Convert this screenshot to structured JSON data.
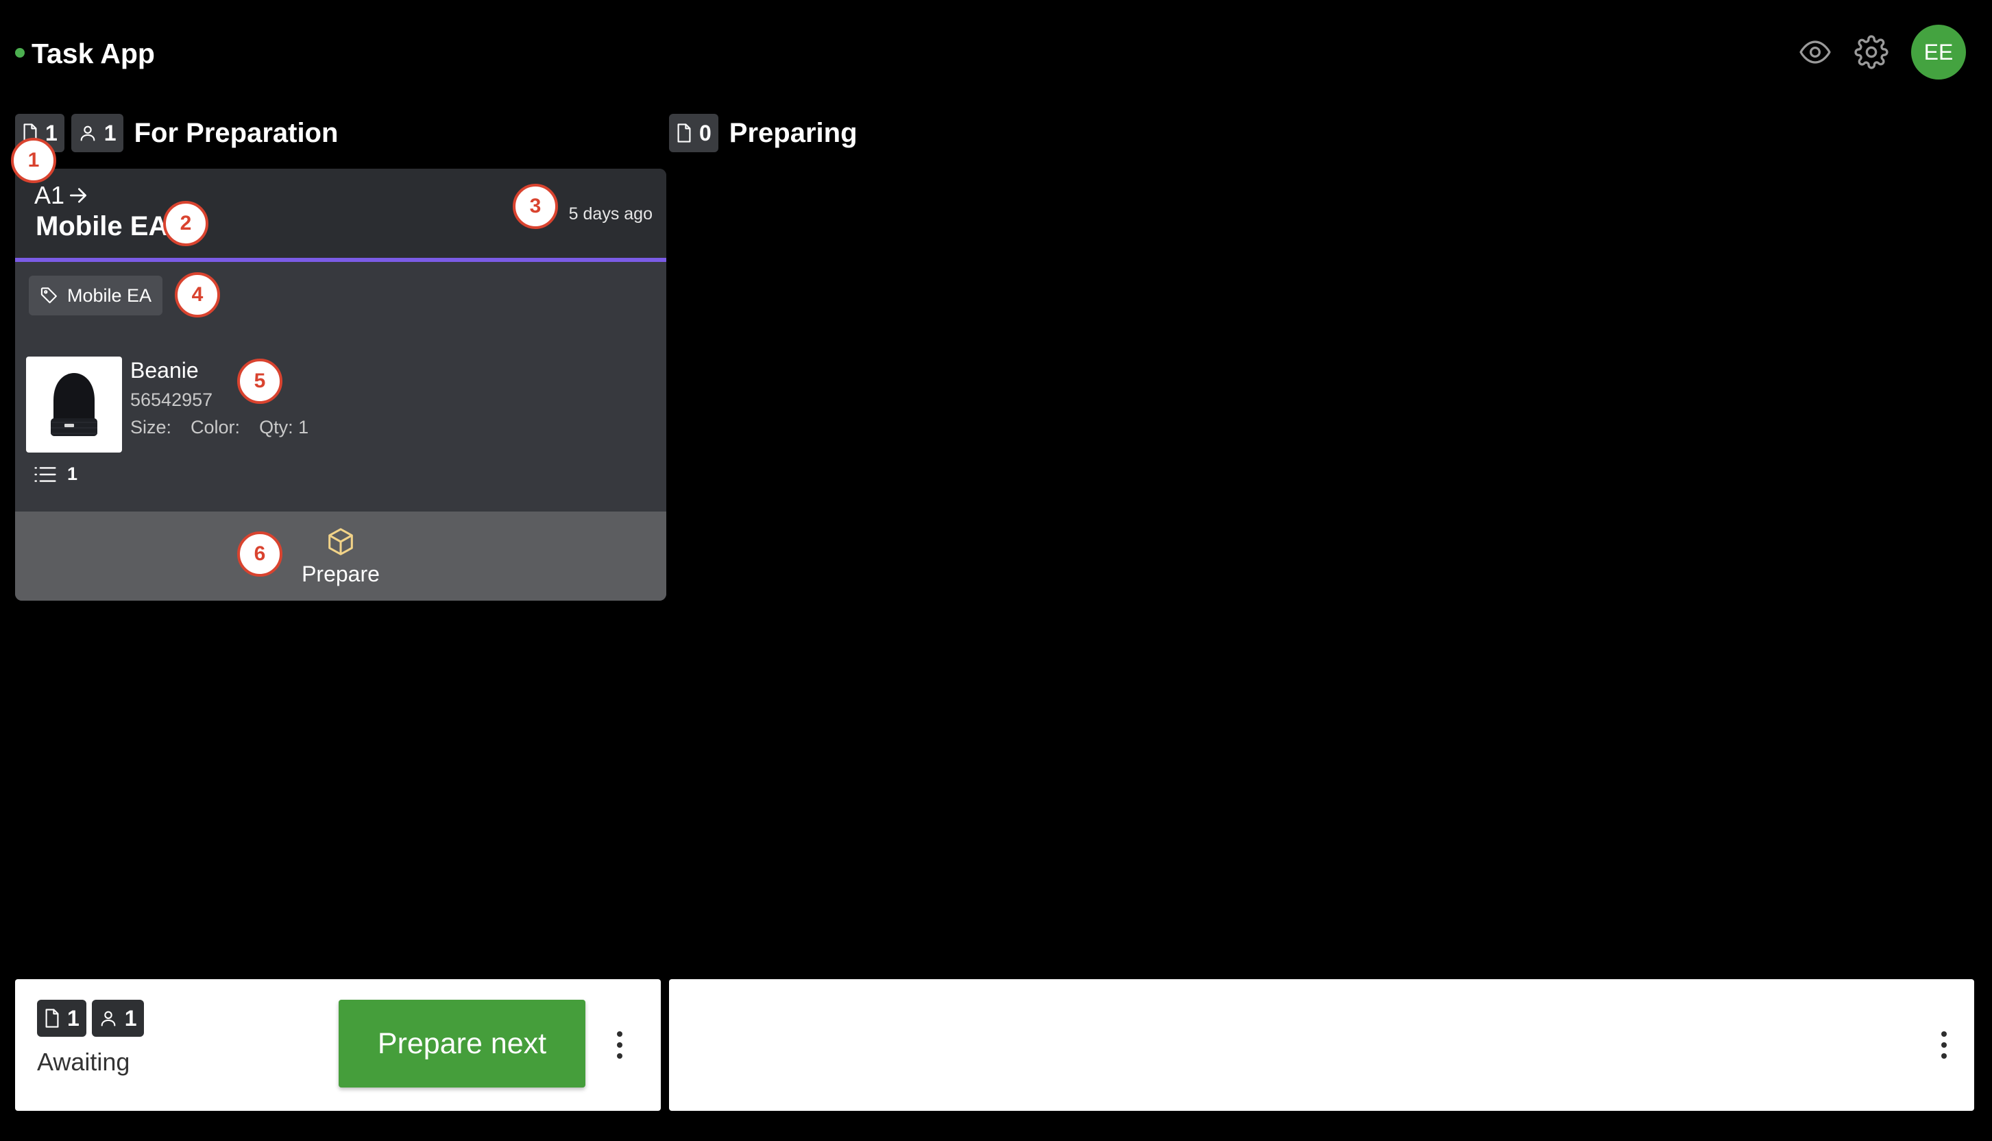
{
  "header": {
    "app_title": "Task App",
    "status_color": "#4caf50",
    "avatar_initials": "EE",
    "avatar_color": "#44a340",
    "icons": [
      "eye-icon",
      "gear-icon"
    ]
  },
  "columns": [
    {
      "doc_count": "1",
      "user_count": "1",
      "title": "For Preparation"
    },
    {
      "doc_count": "0",
      "title": "Preparing"
    }
  ],
  "card": {
    "ref": "A1",
    "title": "Mobile EA",
    "time_ago": "5 days ago",
    "accent_color": "#7b5ce6",
    "tag": "Mobile EA",
    "item": {
      "name": "Beanie",
      "sku": "56542957",
      "size_label": "Size:",
      "color_label": "Color:",
      "qty_label": "Qty: 1",
      "image": "beanie-image"
    },
    "line_count": "1",
    "action_label": "Prepare"
  },
  "markers": [
    "1",
    "2",
    "3",
    "4",
    "5",
    "6"
  ],
  "footer": {
    "doc_count": "1",
    "user_count": "1",
    "status_label": "Awaiting",
    "primary_button": "Prepare next",
    "button_color": "#459e3b"
  }
}
